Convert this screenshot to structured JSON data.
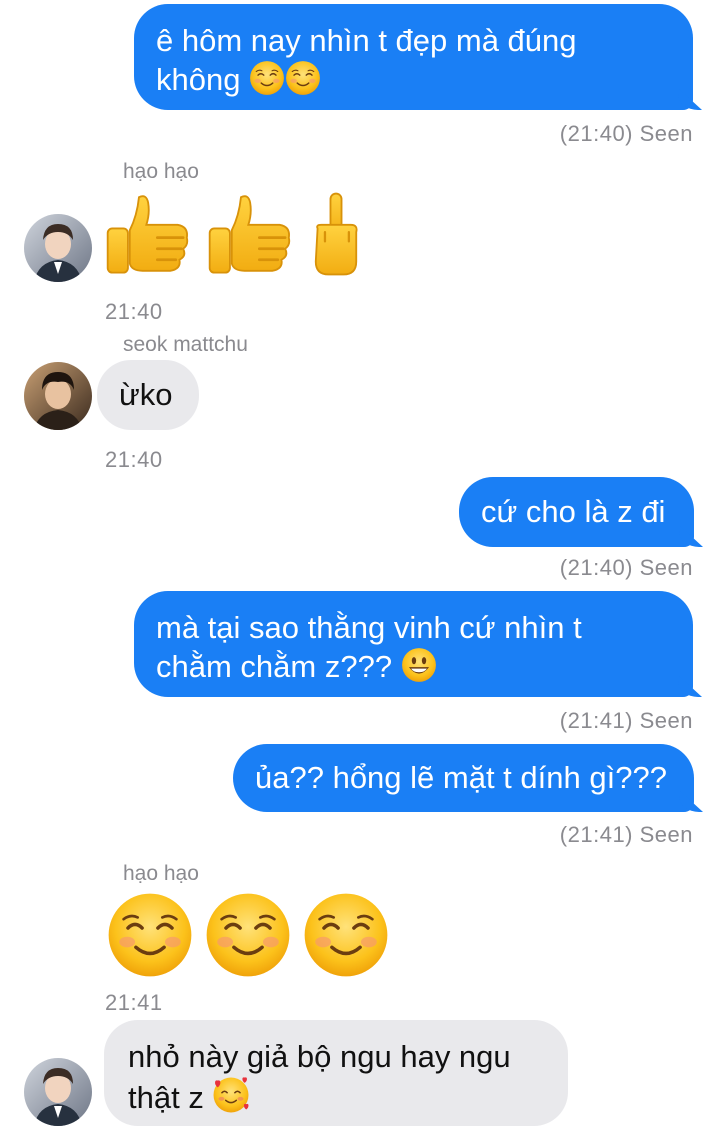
{
  "messages": {
    "m1": {
      "line1": "ê hôm nay nhìn t đẹp mà đúng",
      "line2": "không",
      "status": "(21:40) Seen"
    },
    "m2": {
      "sender": "hạo hạo",
      "time": "21:40"
    },
    "m3": {
      "sender": "seok mattchu",
      "text": "ừko",
      "time": "21:40"
    },
    "m4": {
      "text": "cứ cho là z đi",
      "status": "(21:40) Seen"
    },
    "m5": {
      "line1": "mà tại sao thằng vinh cứ nhìn t",
      "line2": "chằm chằm z???",
      "status": "(21:41) Seen"
    },
    "m6": {
      "text": "ủa?? hổng lẽ mặt t dính gì???",
      "status": "(21:41) Seen"
    },
    "m7": {
      "sender": "hạo hạo",
      "time": "21:41"
    },
    "m8": {
      "line1": "nhỏ này giả bộ ngu hay ngu",
      "line2": "thật z"
    }
  },
  "colors": {
    "outgoing_bubble": "#1a7ff5",
    "incoming_bubble": "#e9e9ec",
    "meta_text": "#8a8a8f"
  },
  "icons": [
    "smiling-face-icon",
    "thumbs-up-icon",
    "middle-finger-icon",
    "grinning-face-icon",
    "smiling-face-with-hearts-icon"
  ]
}
